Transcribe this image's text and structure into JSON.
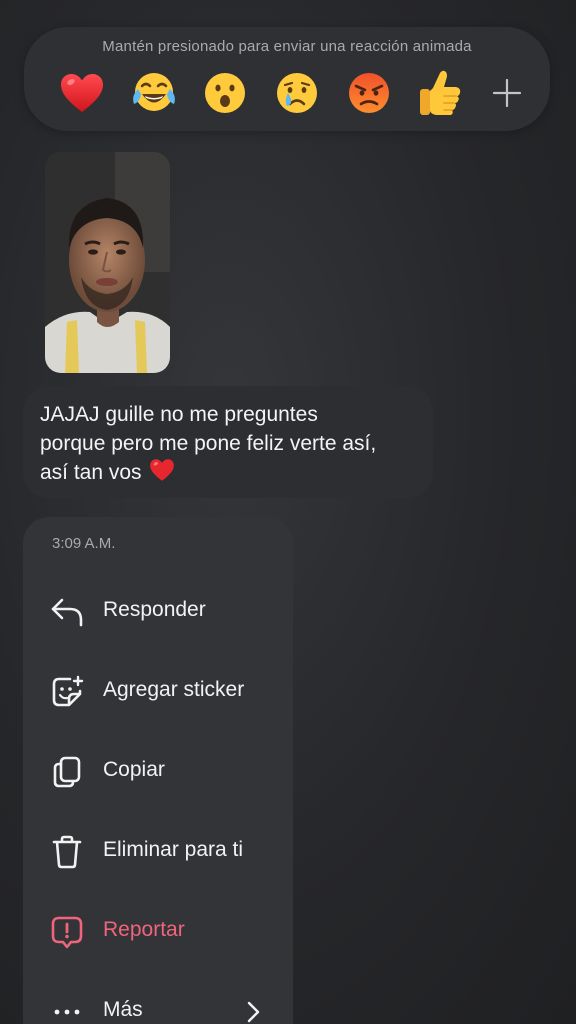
{
  "reaction_bar": {
    "hint": "Mantén presionado para enviar una reacción animada",
    "emojis": [
      {
        "name": "red-heart",
        "glyph": "❤️"
      },
      {
        "name": "face-with-tears-of-joy",
        "glyph": "😂"
      },
      {
        "name": "face-with-open-mouth",
        "glyph": "😮"
      },
      {
        "name": "crying-face",
        "glyph": "😢"
      },
      {
        "name": "angry-face",
        "glyph": "😡"
      },
      {
        "name": "thumbs-up",
        "glyph": "👍"
      }
    ],
    "more_icon": "plus-icon"
  },
  "message": {
    "lines": [
      "JAJAJ guille no me preguntes",
      "porque pero me pone feliz verte así,",
      "así tan vos"
    ],
    "trailing_emoji": "red-heart"
  },
  "menu": {
    "time": "3:09 A.M.",
    "items": [
      {
        "label": "Responder",
        "icon": "reply-icon"
      },
      {
        "label": "Agregar sticker",
        "icon": "add-sticker-icon"
      },
      {
        "label": "Copiar",
        "icon": "copy-icon"
      },
      {
        "label": "Eliminar para ti",
        "icon": "trash-icon"
      },
      {
        "label": "Reportar",
        "icon": "report-icon"
      },
      {
        "label": "Más",
        "icon": "more-icon"
      }
    ]
  },
  "colors": {
    "background": "#262729",
    "surface": "#323437",
    "text": "#f2f2f2",
    "muted": "#a8aaae",
    "danger": "#f0647c",
    "heart": "#e8262e"
  }
}
